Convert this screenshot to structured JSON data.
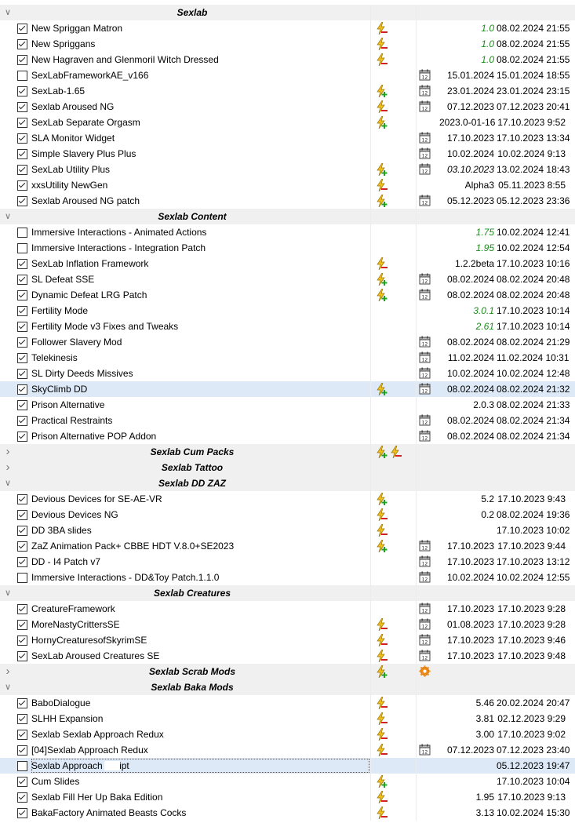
{
  "rows": [
    {
      "type": "separator",
      "name": "Sexlab",
      "expanded": true
    },
    {
      "type": "mod",
      "checked": true,
      "name": "New Spriggan Matron",
      "flags": [
        "warning-bolt-icon"
      ],
      "cal": false,
      "version": "1.0",
      "version_style": "green",
      "date": "08.02.2024 21:55"
    },
    {
      "type": "mod",
      "checked": true,
      "name": "New Spriggans",
      "flags": [
        "warning-bolt-icon"
      ],
      "cal": false,
      "version": "1.0",
      "version_style": "green",
      "date": "08.02.2024 21:55"
    },
    {
      "type": "mod",
      "checked": true,
      "name": "New Hagraven and Glenmoril Witch Dressed",
      "flags": [
        "warning-bolt-icon"
      ],
      "cal": false,
      "version": "1.0",
      "version_style": "green",
      "date": "08.02.2024 21:55"
    },
    {
      "type": "mod",
      "checked": false,
      "name": "SexLabFrameworkAE_v166",
      "flags": [],
      "cal": true,
      "version": "15.01.2024",
      "version_style": "",
      "date": "15.01.2024 18:55"
    },
    {
      "type": "mod",
      "checked": true,
      "name": "SexLab-1.65",
      "flags": [
        "green-bolt-icon"
      ],
      "cal": true,
      "version": "23.01.2024",
      "version_style": "",
      "date": "23.01.2024 23:15"
    },
    {
      "type": "mod",
      "checked": true,
      "name": "Sexlab Aroused NG",
      "flags": [
        "warning-bolt-icon"
      ],
      "cal": true,
      "version": "07.12.2023",
      "version_style": "",
      "date": "07.12.2023 20:41"
    },
    {
      "type": "mod",
      "checked": true,
      "name": "SexLab Separate Orgasm",
      "flags": [
        "green-bolt-icon"
      ],
      "cal": false,
      "version": "2023.0-01-16",
      "version_style": "",
      "date": "17.10.2023 9:52"
    },
    {
      "type": "mod",
      "checked": true,
      "name": "SLA Monitor Widget",
      "flags": [],
      "cal": true,
      "version": "17.10.2023",
      "version_style": "",
      "date": "17.10.2023 13:34"
    },
    {
      "type": "mod",
      "checked": true,
      "name": "Simple Slavery Plus Plus",
      "flags": [],
      "cal": true,
      "version": "10.02.2024",
      "version_style": "",
      "date": "10.02.2024 9:13"
    },
    {
      "type": "mod",
      "checked": true,
      "name": "SexLab Utility Plus",
      "flags": [
        "green-bolt-icon"
      ],
      "cal": true,
      "version": "03.10.2023",
      "version_style": "ital",
      "date": "13.02.2024 18:43"
    },
    {
      "type": "mod",
      "checked": true,
      "name": "xxsUtility NewGen",
      "flags": [
        "warning-bolt-icon"
      ],
      "cal": false,
      "version": "Alpha3",
      "version_style": "",
      "date": "05.11.2023 8:55"
    },
    {
      "type": "mod",
      "checked": true,
      "name": "Sexlab Aroused NG patch",
      "flags": [
        "green-bolt-icon"
      ],
      "cal": true,
      "version": "05.12.2023",
      "version_style": "",
      "date": "05.12.2023 23:36"
    },
    {
      "type": "separator",
      "name": "Sexlab Content",
      "expanded": true
    },
    {
      "type": "mod",
      "checked": false,
      "name": "Immersive Interactions - Animated Actions",
      "flags": [],
      "cal": false,
      "version": "1.75",
      "version_style": "green",
      "date": "10.02.2024 12:41"
    },
    {
      "type": "mod",
      "checked": false,
      "name": "Immersive Interactions - Integration Patch",
      "flags": [],
      "cal": false,
      "version": "1.95",
      "version_style": "green",
      "date": "10.02.2024 12:54"
    },
    {
      "type": "mod",
      "checked": true,
      "name": "SexLab Inflation Framework",
      "flags": [
        "warning-bolt-icon"
      ],
      "cal": false,
      "version": "1.2.2beta",
      "version_style": "",
      "date": "17.10.2023 10:16"
    },
    {
      "type": "mod",
      "checked": true,
      "name": "SL Defeat SSE",
      "flags": [
        "green-bolt-icon"
      ],
      "cal": true,
      "version": "08.02.2024",
      "version_style": "",
      "date": "08.02.2024 20:48"
    },
    {
      "type": "mod",
      "checked": true,
      "name": "Dynamic Defeat LRG Patch",
      "flags": [
        "green-bolt-icon"
      ],
      "cal": true,
      "version": "08.02.2024",
      "version_style": "",
      "date": "08.02.2024 20:48"
    },
    {
      "type": "mod",
      "checked": true,
      "name": "Fertility Mode",
      "flags": [],
      "cal": false,
      "version": "3.0.1",
      "version_style": "green",
      "date": "17.10.2023 10:14"
    },
    {
      "type": "mod",
      "checked": true,
      "name": "Fertility Mode v3 Fixes and Tweaks",
      "flags": [],
      "cal": false,
      "version": "2.61",
      "version_style": "green",
      "date": "17.10.2023 10:14"
    },
    {
      "type": "mod",
      "checked": true,
      "name": "Follower Slavery Mod",
      "flags": [],
      "cal": true,
      "version": "08.02.2024",
      "version_style": "",
      "date": "08.02.2024 21:29"
    },
    {
      "type": "mod",
      "checked": true,
      "name": "Telekinesis",
      "flags": [],
      "cal": true,
      "version": "11.02.2024",
      "version_style": "",
      "date": "11.02.2024 10:31"
    },
    {
      "type": "mod",
      "checked": true,
      "name": "SL Dirty Deeds Missives",
      "flags": [],
      "cal": true,
      "version": "10.02.2024",
      "version_style": "",
      "date": "10.02.2024 12:48"
    },
    {
      "type": "mod",
      "checked": true,
      "name": "SkyClimb DD",
      "flags": [
        "green-bolt-icon"
      ],
      "cal": true,
      "version": "08.02.2024",
      "version_style": "",
      "date": "08.02.2024 21:32",
      "selected": true
    },
    {
      "type": "mod",
      "checked": true,
      "name": "Prison Alternative",
      "flags": [],
      "cal": false,
      "version": "2.0.3",
      "version_style": "",
      "date": "08.02.2024 21:33"
    },
    {
      "type": "mod",
      "checked": true,
      "name": "Practical Restraints",
      "flags": [],
      "cal": true,
      "version": "08.02.2024",
      "version_style": "",
      "date": "08.02.2024 21:34"
    },
    {
      "type": "mod",
      "checked": true,
      "name": "Prison Alternative POP Addon",
      "flags": [],
      "cal": true,
      "version": "08.02.2024",
      "version_style": "",
      "date": "08.02.2024 21:34"
    },
    {
      "type": "separator",
      "name": "Sexlab Cum Packs",
      "expanded": false,
      "flags": [
        "green-bolt-icon",
        "warning-bolt-icon"
      ]
    },
    {
      "type": "separator",
      "name": "Sexlab Tattoo",
      "expanded": false
    },
    {
      "type": "separator",
      "name": "Sexlab DD ZAZ",
      "expanded": true
    },
    {
      "type": "mod",
      "checked": true,
      "name": "Devious Devices for SE-AE-VR",
      "flags": [
        "green-bolt-icon"
      ],
      "cal": false,
      "version": "5.2",
      "version_style": "",
      "date": "17.10.2023 9:43"
    },
    {
      "type": "mod",
      "checked": true,
      "name": "Devious Devices NG",
      "flags": [
        "warning-bolt-icon"
      ],
      "cal": false,
      "version": "0.2",
      "version_style": "",
      "date": "08.02.2024 19:36"
    },
    {
      "type": "mod",
      "checked": true,
      "name": "DD 3BA slides",
      "flags": [
        "warning-bolt-icon"
      ],
      "cal": false,
      "version": "",
      "version_style": "",
      "date": "17.10.2023 10:02"
    },
    {
      "type": "mod",
      "checked": true,
      "name": "ZaZ Animation Pack+ CBBE HDT V.8.0+SE2023",
      "flags": [
        "green-bolt-icon"
      ],
      "cal": true,
      "version": "17.10.2023",
      "version_style": "",
      "date": "17.10.2023 9:44"
    },
    {
      "type": "mod",
      "checked": true,
      "name": "DD - I4 Patch v7",
      "flags": [],
      "cal": true,
      "version": "17.10.2023",
      "version_style": "",
      "date": "17.10.2023 13:12"
    },
    {
      "type": "mod",
      "checked": false,
      "name": "Immersive Interactions - DD&Toy Patch.1.1.0",
      "flags": [],
      "cal": true,
      "version": "10.02.2024",
      "version_style": "",
      "date": "10.02.2024 12:55"
    },
    {
      "type": "separator",
      "name": "Sexlab Creatures",
      "expanded": true
    },
    {
      "type": "mod",
      "checked": true,
      "name": "CreatureFramework",
      "flags": [],
      "cal": true,
      "version": "17.10.2023",
      "version_style": "",
      "date": "17.10.2023 9:28"
    },
    {
      "type": "mod",
      "checked": true,
      "name": "MoreNastyCrittersSE",
      "flags": [
        "warning-bolt-icon"
      ],
      "cal": true,
      "version": "01.08.2023",
      "version_style": "",
      "date": "17.10.2023 9:28"
    },
    {
      "type": "mod",
      "checked": true,
      "name": "HornyCreaturesofSkyrimSE",
      "flags": [
        "warning-bolt-icon"
      ],
      "cal": true,
      "version": "17.10.2023",
      "version_style": "",
      "date": "17.10.2023 9:46"
    },
    {
      "type": "mod",
      "checked": true,
      "name": "SexLab Aroused Creatures SE",
      "flags": [
        "warning-bolt-icon"
      ],
      "cal": true,
      "version": "17.10.2023",
      "version_style": "",
      "date": "17.10.2023 9:48"
    },
    {
      "type": "separator",
      "name": "Sexlab Scrab Mods",
      "expanded": false,
      "flags": [
        "green-bolt-icon"
      ],
      "gear": true
    },
    {
      "type": "separator",
      "name": "Sexlab Baka Mods",
      "expanded": true
    },
    {
      "type": "mod",
      "checked": true,
      "name": "BaboDialogue",
      "flags": [
        "warning-bolt-icon"
      ],
      "cal": false,
      "version": "5.46",
      "version_style": "",
      "date": "20.02.2024 20:47"
    },
    {
      "type": "mod",
      "checked": true,
      "name": "SLHH Expansion",
      "flags": [
        "warning-bolt-icon"
      ],
      "cal": false,
      "version": "3.81",
      "version_style": "",
      "date": "02.12.2023 9:29"
    },
    {
      "type": "mod",
      "checked": true,
      "name": "Sexlab Sexlab Approach Redux",
      "flags": [
        "warning-bolt-icon"
      ],
      "cal": false,
      "version": "3.00",
      "version_style": "",
      "date": "17.10.2023 9:02"
    },
    {
      "type": "mod",
      "checked": true,
      "name": "[04]Sexlab Approach Redux",
      "flags": [
        "warning-bolt-icon"
      ],
      "cal": true,
      "version": "07.12.2023",
      "version_style": "",
      "date": "07.12.2023 23:40"
    },
    {
      "type": "mod",
      "checked": false,
      "name": "Sexlab Approach       Script",
      "flags": [],
      "cal": false,
      "version": "",
      "version_style": "",
      "date": "05.12.2023 19:47",
      "selected": true,
      "focus": true,
      "blot": true
    },
    {
      "type": "mod",
      "checked": true,
      "name": "Cum Slides",
      "flags": [
        "green-bolt-icon"
      ],
      "cal": false,
      "version": "",
      "version_style": "",
      "date": "17.10.2023 10:04"
    },
    {
      "type": "mod",
      "checked": true,
      "name": "Sexlab Fill Her Up Baka Edition",
      "flags": [
        "warning-bolt-icon"
      ],
      "cal": false,
      "version": "1.95",
      "version_style": "",
      "date": "17.10.2023 9:13"
    },
    {
      "type": "mod",
      "checked": true,
      "name": "BakaFactory Animated Beasts Cocks",
      "flags": [
        "warning-bolt-icon"
      ],
      "cal": false,
      "version": "3.13",
      "version_style": "",
      "date": "10.02.2024 15:30"
    }
  ]
}
